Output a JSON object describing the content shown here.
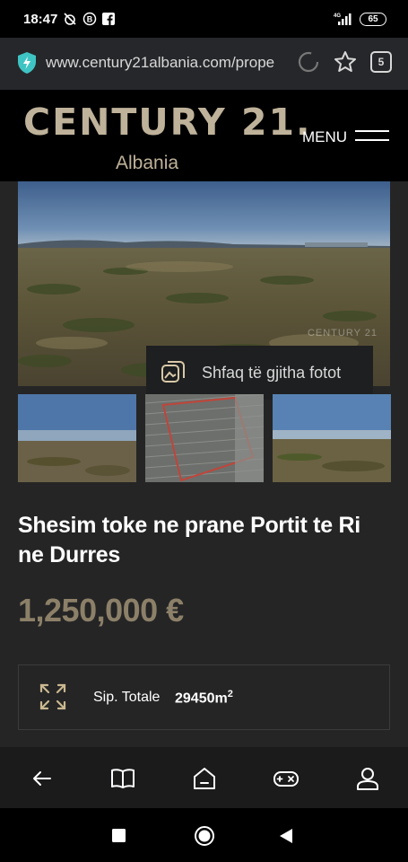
{
  "status_bar": {
    "time": "18:47",
    "network": "4G",
    "battery": "65"
  },
  "browser": {
    "url": "www.century21albania.com/prope",
    "tab_count": "5"
  },
  "site_header": {
    "logo_main": "CENTURY 21.",
    "logo_sub": "Albania",
    "menu_label": "MENU"
  },
  "gallery": {
    "watermark": "CENTURY 21",
    "show_all_label": "Shfaq të gjitha fotot"
  },
  "listing": {
    "title": "Shesim toke ne prane Portit te Ri ne Durres",
    "price": "1,250,000 €",
    "area_label": "Sip. Totale",
    "area_value": "29450",
    "area_unit": "m",
    "area_unit_exp": "2"
  },
  "colors": {
    "brand_gold": "#bfb29a",
    "price_gold": "#8c8068",
    "content_bg": "#252526"
  }
}
